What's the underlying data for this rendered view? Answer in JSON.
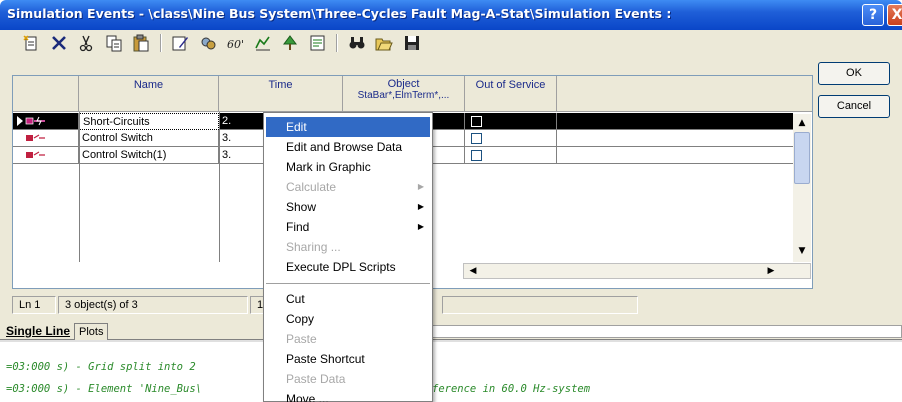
{
  "window": {
    "title": "Simulation Events - \\class\\Nine Bus System\\Three-Cycles Fault Mag-A-Stat\\Simulation Events :",
    "help_label": "?",
    "close_label": "X"
  },
  "toolbar": {
    "icons": [
      "new-object-icon",
      "delete-icon",
      "cut-icon",
      "copy-icon",
      "paste-icon",
      "edit-object-icon",
      "detail-mode-icon",
      "variables-icon",
      "filter-icon",
      "tree-icon",
      "notes-icon",
      "find-icon",
      "open-icon",
      "save-icon"
    ]
  },
  "buttons": {
    "ok": "OK",
    "cancel": "Cancel"
  },
  "grid": {
    "columns": {
      "name": "Name",
      "time": "Time",
      "object_line1": "Object",
      "object_line2": "StaBar*,ElmTerm*,...",
      "out_of_service": "Out of Service"
    },
    "rows": [
      {
        "name": "Short-Circuits",
        "time": "2.",
        "selected": true
      },
      {
        "name": "Control Switch",
        "time": "3.",
        "selected": false
      },
      {
        "name": "Control Switch(1)",
        "time": "3.",
        "selected": false
      }
    ]
  },
  "status": {
    "line": "Ln 1",
    "count": "3 object(s) of 3",
    "extra": "1"
  },
  "output_tabs": {
    "single_line": "Single Line",
    "plots": "Plots"
  },
  "output_lines": [
    "=03:000 s) - Grid split into 2",
    "=03:000 s) - Element 'Nine_Bus\\",
    "ference in 60.0 Hz-system"
  ],
  "context_menu": {
    "items": [
      {
        "label": "Edit",
        "state": "highlighted",
        "submenu": false
      },
      {
        "label": "Edit and Browse Data",
        "state": "normal",
        "submenu": false
      },
      {
        "label": "Mark in Graphic",
        "state": "normal",
        "submenu": false
      },
      {
        "label": "Calculate",
        "state": "disabled",
        "submenu": true
      },
      {
        "label": "Show",
        "state": "normal",
        "submenu": true
      },
      {
        "label": "Find",
        "state": "normal",
        "submenu": true
      },
      {
        "label": "Sharing ...",
        "state": "disabled",
        "submenu": false
      },
      {
        "label": "Execute DPL Scripts",
        "state": "normal",
        "submenu": false
      },
      {
        "label": "Cut",
        "state": "normal",
        "submenu": false
      },
      {
        "label": "Copy",
        "state": "normal",
        "submenu": false
      },
      {
        "label": "Paste",
        "state": "disabled",
        "submenu": false
      },
      {
        "label": "Paste Shortcut",
        "state": "normal",
        "submenu": false
      },
      {
        "label": "Paste Data",
        "state": "disabled",
        "submenu": false
      },
      {
        "label": "Move ...",
        "state": "normal",
        "submenu": false
      }
    ]
  },
  "colors": {
    "title_bar": "#0a46c8",
    "menu_highlight": "#316ac5",
    "output_text": "#2a8a2a"
  }
}
